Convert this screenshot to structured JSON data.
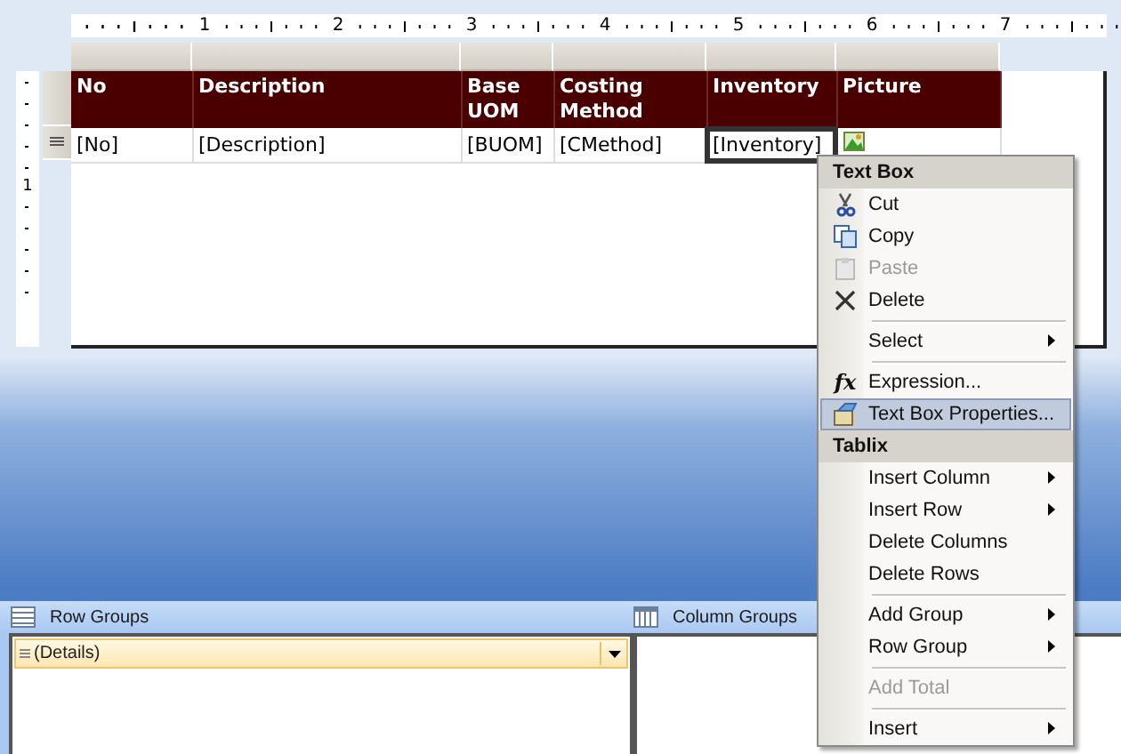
{
  "ruler": {
    "marks": [
      "1",
      "2",
      "3",
      "4",
      "5",
      "6",
      "7"
    ]
  },
  "vertical_ruler": {
    "marks": [
      "1"
    ]
  },
  "tablix": {
    "columns": [
      {
        "header": "No",
        "cell": "[No]",
        "selected": false,
        "kind": "text"
      },
      {
        "header": "Description",
        "cell": "[Description]",
        "selected": false,
        "kind": "text"
      },
      {
        "header": "Base UOM",
        "cell": "[BUOM]",
        "selected": false,
        "kind": "text"
      },
      {
        "header": "Costing Method",
        "cell": "[CMethod]",
        "selected": false,
        "kind": "text"
      },
      {
        "header": "Inventory",
        "cell": "[Inventory]",
        "selected": true,
        "kind": "text"
      },
      {
        "header": "Picture",
        "selected": false,
        "kind": "image"
      }
    ]
  },
  "context_menu": {
    "sections": [
      {
        "title": "Text Box",
        "items": [
          {
            "kind": "cut",
            "label": "Cut",
            "disabled": false,
            "submenu": false,
            "highlighted": false
          },
          {
            "kind": "copy",
            "label": "Copy",
            "disabled": false,
            "submenu": false,
            "highlighted": false
          },
          {
            "kind": "paste",
            "label": "Paste",
            "disabled": true,
            "submenu": false,
            "highlighted": false
          },
          {
            "kind": "delete",
            "label": "Delete",
            "disabled": false,
            "submenu": false,
            "highlighted": false
          },
          {
            "kind": "separator"
          },
          {
            "kind": "item",
            "label": "Select",
            "disabled": false,
            "submenu": true,
            "highlighted": false
          },
          {
            "kind": "separator"
          },
          {
            "kind": "item",
            "label": "Expression...",
            "glyph": "fx",
            "disabled": false,
            "submenu": false,
            "highlighted": false
          },
          {
            "kind": "properties",
            "label": "Text Box Properties...",
            "disabled": false,
            "submenu": false,
            "highlighted": true
          }
        ]
      },
      {
        "title": "Tablix",
        "items": [
          {
            "kind": "item",
            "label": "Insert Column",
            "disabled": false,
            "submenu": true,
            "highlighted": false
          },
          {
            "kind": "item",
            "label": "Insert Row",
            "disabled": false,
            "submenu": true,
            "highlighted": false
          },
          {
            "kind": "item",
            "label": "Delete Columns",
            "disabled": false,
            "submenu": false,
            "highlighted": false
          },
          {
            "kind": "item",
            "label": "Delete Rows",
            "disabled": false,
            "submenu": false,
            "highlighted": false
          },
          {
            "kind": "separator"
          },
          {
            "kind": "item",
            "label": "Add Group",
            "disabled": false,
            "submenu": true,
            "highlighted": false
          },
          {
            "kind": "item",
            "label": "Row Group",
            "disabled": false,
            "submenu": true,
            "highlighted": false
          },
          {
            "kind": "separator"
          },
          {
            "kind": "item",
            "label": "Add Total",
            "disabled": true,
            "submenu": false,
            "highlighted": false
          },
          {
            "kind": "separator"
          },
          {
            "kind": "item",
            "label": "Insert",
            "disabled": false,
            "submenu": true,
            "highlighted": false
          }
        ]
      }
    ]
  },
  "row_groups": {
    "title": "Row Groups",
    "items": [
      {
        "label": "(Details)",
        "selected": true
      }
    ]
  },
  "column_groups": {
    "title": "Column Groups"
  }
}
